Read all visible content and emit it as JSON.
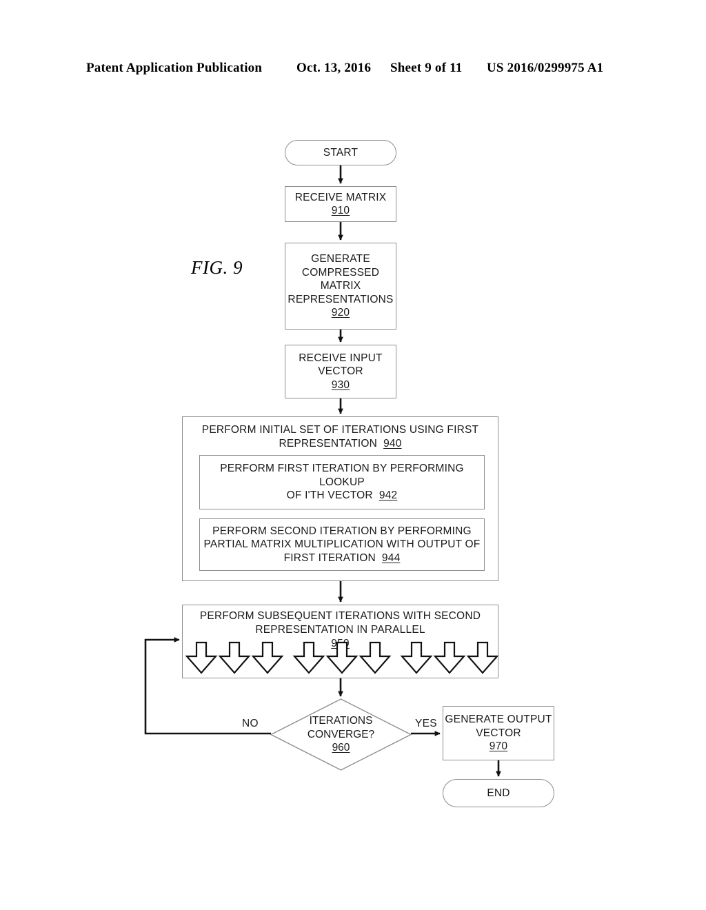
{
  "header": {
    "title": "Patent Application Publication",
    "date": "Oct. 13, 2016",
    "sheet": "Sheet 9 of 11",
    "publication_number": "US 2016/0299975 A1"
  },
  "figure": {
    "label": "FIG. 9"
  },
  "flowchart": {
    "start": {
      "label": "START"
    },
    "step_910": {
      "label": "RECEIVE MATRIX",
      "ref": "910"
    },
    "step_920": {
      "label": "GENERATE\nCOMPRESSED\nMATRIX\nREPRESENTATIONS",
      "ref": "920"
    },
    "step_930": {
      "label": "RECEIVE INPUT\nVECTOR",
      "ref": "930"
    },
    "step_940": {
      "label": "PERFORM INITIAL SET OF ITERATIONS USING FIRST\nREPRESENTATION",
      "ref": "940"
    },
    "step_942": {
      "label": "PERFORM FIRST ITERATION BY PERFORMING LOOKUP\nOF I'TH VECTOR",
      "ref": "942"
    },
    "step_944": {
      "label": "PERFORM SECOND ITERATION BY PERFORMING\nPARTIAL MATRIX MULTIPLICATION WITH OUTPUT OF\nFIRST ITERATION",
      "ref": "944"
    },
    "step_950": {
      "label": "PERFORM SUBSEQUENT ITERATIONS WITH SECOND\nREPRESENTATION IN PARALLEL",
      "ref": "950",
      "parallel_arrow_count": 9,
      "parallel_arrow_groups": 3
    },
    "decision_960": {
      "label": "ITERATIONS\nCONVERGE?",
      "ref": "960"
    },
    "step_970": {
      "label": "GENERATE OUTPUT\nVECTOR",
      "ref": "970"
    },
    "end": {
      "label": "END"
    },
    "edges": {
      "no_label": "NO",
      "yes_label": "YES"
    }
  },
  "colors": {
    "ink": "#1a1a1a",
    "node_border": "#8d8d8d",
    "connector": "#111111",
    "background": "#ffffff"
  }
}
